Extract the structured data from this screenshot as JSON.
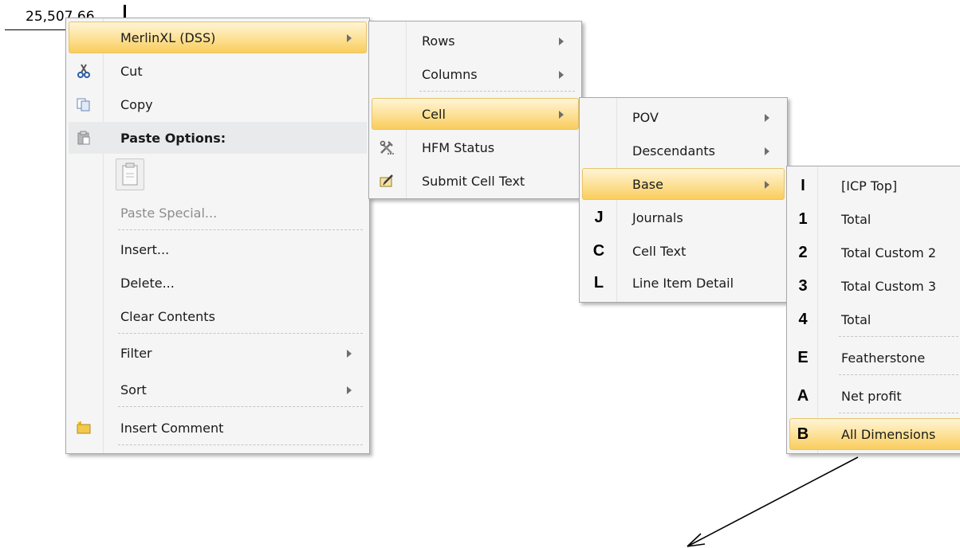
{
  "cell": {
    "value": "25,507.66"
  },
  "menu1": {
    "items": [
      {
        "label": "MerlinXL  (DSS)"
      },
      {
        "label": "Cut"
      },
      {
        "label": "Copy"
      },
      {
        "label": "Paste Options:"
      },
      {
        "label": ""
      },
      {
        "label": "Paste Special..."
      },
      {
        "label": "Insert..."
      },
      {
        "label": "Delete..."
      },
      {
        "label": "Clear Contents"
      },
      {
        "label": "Filter"
      },
      {
        "label": "Sort"
      },
      {
        "label": "Insert Comment"
      }
    ]
  },
  "menu2": {
    "items": [
      {
        "label": "Rows"
      },
      {
        "label": "Columns"
      },
      {
        "label": "Cell"
      },
      {
        "label": "HFM Status"
      },
      {
        "label": "Submit Cell Text"
      }
    ]
  },
  "menu3": {
    "items": [
      {
        "label": "POV",
        "key": ""
      },
      {
        "label": "Descendants",
        "key": ""
      },
      {
        "label": "Base",
        "key": ""
      },
      {
        "label": "Journals",
        "key": "J"
      },
      {
        "label": "Cell Text",
        "key": "C"
      },
      {
        "label": "Line Item Detail",
        "key": "L"
      }
    ]
  },
  "menu4": {
    "items": [
      {
        "label": "[ICP Top]",
        "key": "I"
      },
      {
        "label": "Total",
        "key": "1"
      },
      {
        "label": "Total Custom 2",
        "key": "2"
      },
      {
        "label": "Total Custom 3",
        "key": "3"
      },
      {
        "label": "Total",
        "key": "4"
      },
      {
        "label": "Featherstone",
        "key": "E"
      },
      {
        "label": "Net profit",
        "key": "A"
      },
      {
        "label": "All Dimensions",
        "key": "B"
      }
    ]
  },
  "colors": {
    "highlight": "#f9cd5d",
    "menu_bg": "#f5f5f5",
    "border": "#a8a8a8"
  }
}
